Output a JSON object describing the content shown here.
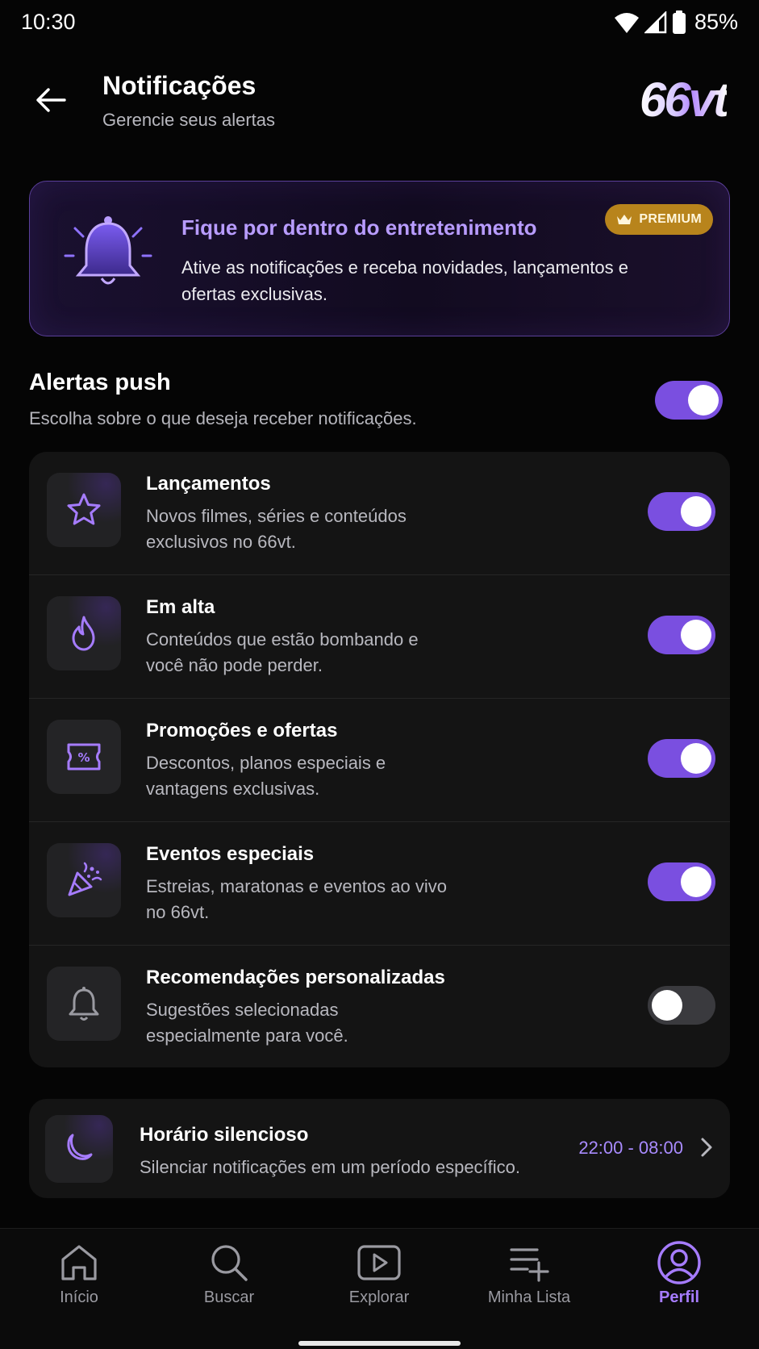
{
  "status_bar": {
    "time": "10:30",
    "battery": "85%"
  },
  "header": {
    "title": "Notificações",
    "subtitle": "Gerencie seus alertas",
    "logo": "66vt"
  },
  "promo": {
    "title": "Fique por dentro do entretenimento",
    "text": "Ative as notificações e receba novidades, lançamentos e ofertas exclusivas.",
    "badge": "PREMIUM",
    "accent": "#b89cff"
  },
  "push": {
    "title": "Alertas push",
    "subtitle": "Escolha sobre o que deseja receber notificações.",
    "enabled": true
  },
  "items": [
    {
      "title": "Lançamentos",
      "desc": "Novos filmes, séries e conteúdos exclusivos no 66vt.",
      "icon": "star-icon",
      "enabled": true
    },
    {
      "title": "Em alta",
      "desc": "Conteúdos que estão bombando e você não pode perder.",
      "icon": "flame-icon",
      "enabled": true
    },
    {
      "title": "Promoções e ofertas",
      "desc": "Descontos, planos especiais e vantagens exclusivas.",
      "icon": "discount-ticket-icon",
      "enabled": true
    },
    {
      "title": "Eventos especiais",
      "desc": "Estreias, maratonas e eventos ao vivo no 66vt.",
      "icon": "party-popper-icon",
      "enabled": true
    },
    {
      "title": "Recomendações personalizadas",
      "desc": "Sugestões selecionadas especialmente para você.",
      "icon": "bell-icon",
      "enabled": false
    }
  ],
  "quiet_hours": {
    "title": "Horário silencioso",
    "desc": "Silenciar notificações em um período específico.",
    "time": "22:00 - 08:00",
    "icon": "moon-icon"
  },
  "nav": [
    {
      "label": "Início",
      "icon": "home-icon",
      "active": false
    },
    {
      "label": "Buscar",
      "icon": "search-icon",
      "active": false
    },
    {
      "label": "Explorar",
      "icon": "play-icon",
      "active": false
    },
    {
      "label": "Minha Lista",
      "icon": "playlist-add-icon",
      "active": false
    },
    {
      "label": "Perfil",
      "icon": "profile-icon",
      "active": true
    }
  ],
  "colors": {
    "accent": "#7a4fe0",
    "accent_text": "#a67cff",
    "premium": "#b8841c"
  }
}
